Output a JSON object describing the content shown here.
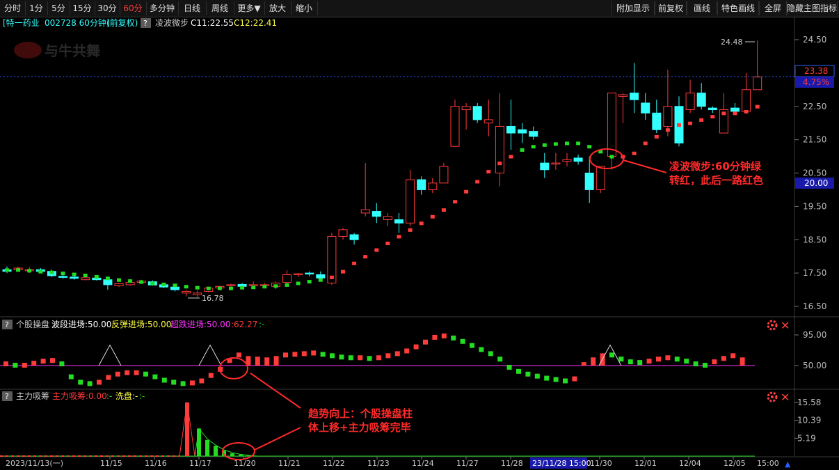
{
  "toolbar": {
    "left": [
      {
        "label": "分时"
      },
      {
        "label": "1分"
      },
      {
        "label": "5分"
      },
      {
        "label": "15分"
      },
      {
        "label": "30分"
      },
      {
        "label": "60分",
        "active": true
      },
      {
        "label": "多分钟"
      },
      {
        "label": "日线"
      },
      {
        "label": "周线"
      },
      {
        "label": "更多▼"
      },
      {
        "label": "放大"
      },
      {
        "label": "缩小"
      }
    ],
    "right": [
      {
        "label": "附加显示"
      },
      {
        "label": "前复权"
      },
      {
        "label": "画线"
      },
      {
        "label": "特色画线"
      },
      {
        "label": "全屏"
      },
      {
        "label": "隐藏主图指标"
      }
    ]
  },
  "header": {
    "stock_name": "[特一药业",
    "code_period": "002728 60分钟]",
    "adjust": "(前复权)",
    "indicator_name": "凌波微步",
    "c1": "C11:22.55",
    "c2": "C12:22.41"
  },
  "watermark": "与牛共舞",
  "price_labels": {
    "max": "24.48",
    "min": "16.78",
    "current": "23.38",
    "change": "4.75%",
    "box_level": "20.00"
  },
  "y_axis_main": [
    "24.50",
    "23.50",
    "22.50",
    "21.50",
    "20.50",
    "19.50",
    "18.50",
    "17.50",
    "16.50"
  ],
  "annotations": {
    "main_1": "凌波微步:60分钟绿",
    "main_2": "转红，此后一路红色",
    "sub_1": "趋势向上：个股操盘柱",
    "sub_2": "体上移+主力吸筹完毕"
  },
  "panel2": {
    "help": "?",
    "title": "个股操盘",
    "l1": "波段进场:50.00",
    "l2": "反弹进场:50.00",
    "l3": "超跌进场:50.00",
    "l4": ":62.27",
    "l5": ":-",
    "axis": [
      "95.00",
      "50.00"
    ]
  },
  "panel3": {
    "help": "?",
    "title": "主力吸筹",
    "l1": "主力吸筹:0.00",
    "l2": ":-",
    "l3": "洗盘:-",
    "l4": ":-",
    "axis": [
      "15.58",
      "10.39",
      "5.19"
    ]
  },
  "x_axis": {
    "first": "2023/11/13(一)",
    "labels": [
      "11/15",
      "11/16",
      "11/17",
      "11/20",
      "11/21",
      "11/22",
      "11/23",
      "11/24",
      "11/27",
      "11/28",
      "11/30",
      "12/01",
      "12/04",
      "12/05"
    ],
    "cursor": "23/11/28 15:00",
    "last": "15:00"
  },
  "colors": {
    "up": "#ff3b3b",
    "down": "#33ffff",
    "green": "#22dd22",
    "magenta": "#ff33ff",
    "dotted": "#2050ff",
    "annot": "#ff2a2a"
  },
  "chart_data": {
    "type": "candlestick",
    "ohlc": [
      [
        17.6,
        17.7,
        17.5,
        17.55
      ],
      [
        17.6,
        17.68,
        17.55,
        17.65
      ],
      [
        17.58,
        17.68,
        17.5,
        17.6
      ],
      [
        17.6,
        17.65,
        17.55,
        17.55
      ],
      [
        17.55,
        17.6,
        17.38,
        17.42
      ],
      [
        17.4,
        17.45,
        17.33,
        17.38
      ],
      [
        17.38,
        17.42,
        17.3,
        17.34
      ],
      [
        17.3,
        17.42,
        17.28,
        17.36
      ],
      [
        17.35,
        17.4,
        17.28,
        17.3
      ],
      [
        17.3,
        17.35,
        17.0,
        17.15
      ],
      [
        17.12,
        17.2,
        17.08,
        17.18
      ],
      [
        17.15,
        17.24,
        17.12,
        17.22
      ],
      [
        17.22,
        17.3,
        17.18,
        17.26
      ],
      [
        17.24,
        17.28,
        17.12,
        17.14
      ],
      [
        17.15,
        17.18,
        17.05,
        17.08
      ],
      [
        17.08,
        17.12,
        16.95,
        17.0
      ],
      [
        16.9,
        17.0,
        16.8,
        16.95
      ],
      [
        16.85,
        16.98,
        16.78,
        16.9
      ],
      [
        16.95,
        17.08,
        16.92,
        17.05
      ],
      [
        17.05,
        17.12,
        17.0,
        17.1
      ],
      [
        17.12,
        17.18,
        17.05,
        17.15
      ],
      [
        17.16,
        17.2,
        17.08,
        17.1
      ],
      [
        17.12,
        17.25,
        17.08,
        17.15
      ],
      [
        17.13,
        17.2,
        17.1,
        17.15
      ],
      [
        17.1,
        17.25,
        17.02,
        17.2
      ],
      [
        17.22,
        17.58,
        17.2,
        17.45
      ],
      [
        17.45,
        17.5,
        17.38,
        17.48
      ],
      [
        17.5,
        17.55,
        17.4,
        17.48
      ],
      [
        17.45,
        17.55,
        17.3,
        17.35
      ],
      [
        17.2,
        18.7,
        17.15,
        18.6
      ],
      [
        18.6,
        18.85,
        18.5,
        18.8
      ],
      [
        18.65,
        18.7,
        18.35,
        18.5
      ],
      [
        19.3,
        20.8,
        19.2,
        19.4
      ],
      [
        19.35,
        19.6,
        19.0,
        19.2
      ],
      [
        19.1,
        19.3,
        18.9,
        19.2
      ],
      [
        19.1,
        19.3,
        18.7,
        19.0
      ],
      [
        19.0,
        20.6,
        18.9,
        20.3
      ],
      [
        20.3,
        20.4,
        19.85,
        20.0
      ],
      [
        20.0,
        20.35,
        19.9,
        20.2
      ],
      [
        20.2,
        20.8,
        20.2,
        20.7
      ],
      [
        21.3,
        22.7,
        21.3,
        22.5
      ],
      [
        22.4,
        22.6,
        21.8,
        22.5
      ],
      [
        22.5,
        22.6,
        22.0,
        22.1
      ],
      [
        22.0,
        22.7,
        21.6,
        22.1
      ],
      [
        20.5,
        22.9,
        20.1,
        21.9
      ],
      [
        21.9,
        22.7,
        21.2,
        21.7
      ],
      [
        21.8,
        22.0,
        21.4,
        21.7
      ],
      [
        21.75,
        21.9,
        21.5,
        21.6
      ],
      [
        20.8,
        21.1,
        20.35,
        20.6
      ],
      [
        20.8,
        21.1,
        20.6,
        20.8
      ],
      [
        20.85,
        21.1,
        20.7,
        20.9
      ],
      [
        20.95,
        21.05,
        20.75,
        20.85
      ],
      [
        20.5,
        21.0,
        19.6,
        20.0
      ],
      [
        20.0,
        20.7,
        19.9,
        20.7
      ],
      [
        21.0,
        22.9,
        20.6,
        22.9
      ],
      [
        22.8,
        22.9,
        22.0,
        22.85
      ],
      [
        22.9,
        23.8,
        22.3,
        22.7
      ],
      [
        22.6,
        22.9,
        22.1,
        22.3
      ],
      [
        22.3,
        22.7,
        21.7,
        21.8
      ],
      [
        21.9,
        23.6,
        21.6,
        22.5
      ],
      [
        22.5,
        22.8,
        21.3,
        21.4
      ],
      [
        22.4,
        23.3,
        22.3,
        22.9
      ],
      [
        22.9,
        23.2,
        22.4,
        22.5
      ],
      [
        22.45,
        22.5,
        22.3,
        22.4
      ],
      [
        21.7,
        22.9,
        21.7,
        22.4
      ],
      [
        22.45,
        22.6,
        22.3,
        22.35
      ],
      [
        22.35,
        23.5,
        22.3,
        23.0
      ],
      [
        23.0,
        24.48,
        23.0,
        23.38
      ]
    ]
  }
}
